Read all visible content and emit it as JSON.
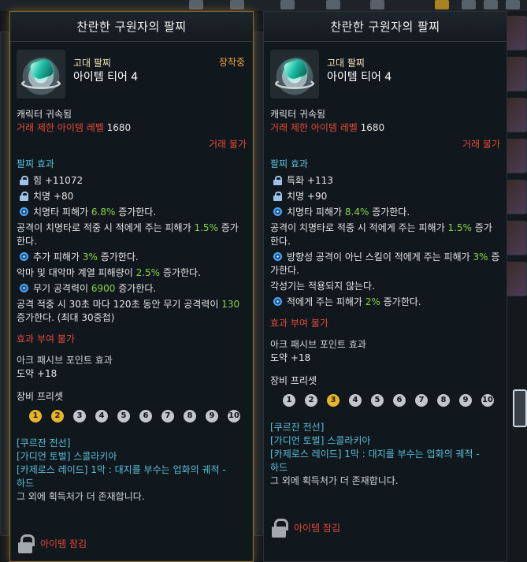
{
  "left": {
    "title": "찬란한 구원자의 팔찌",
    "grade": "고대 팔찌",
    "tier": "아이템 티어 4",
    "equipped": "장착중",
    "bound": "캐릭터 귀속됨",
    "level_label": "거래 제한 아이템 레벨",
    "level_value": "1680",
    "trade": "거래 불가",
    "effect_header": "팔찌 효과",
    "stat1": "힘 +11072",
    "stat2": "치명 +80",
    "e1a": "치명타 피해가 ",
    "e1v": "6.8%",
    "e1b": " 증가한다.",
    "e2a": "공격이 치명타로 적중 시 적에게 주는 피해가 ",
    "e2v": "1.5%",
    "e2b": " 증가한다.",
    "e3a": "추가 피해가 ",
    "e3v": "3%",
    "e3b": " 증가한다.",
    "e4a": "악마 및 대악마 계열 피해량이 ",
    "e4v": "2.5%",
    "e4b": " 증가한다.",
    "e5a": "무기 공격력이 ",
    "e5v": "6900",
    "e5b": " 증가한다.",
    "e6a": "공격 적중 시 30초 마다 120초 동안 무기 공격력이 ",
    "e6v": "130",
    "e6b": " 증가한다. (최대 30중첩)",
    "no_effect": "효과 부여 불가",
    "ark_header": "아크 패시브 포인트 효과",
    "ark_value": "도약 +18",
    "preset_header": "장비 프리셋",
    "preset": [
      "1",
      "2",
      "3",
      "4",
      "5",
      "6",
      "7",
      "8",
      "9",
      "10"
    ],
    "src1": "[쿠르잔 전선]",
    "src2": "[가디언 토벌] 스콜라키아",
    "src3": "[카제로스 레이드] 1막 : 대지를 부수는 업화의 궤적 -",
    "src3b": "하드",
    "src4": "그 외에 획득처가 더 존재합니다.",
    "locked": "아이템 잠김"
  },
  "right": {
    "title": "찬란한 구원자의 팔찌",
    "grade": "고대 팔찌",
    "tier": "아이템 티어 4",
    "bound": "캐릭터 귀속됨",
    "level_label": "거래 제한 아이템 레벨",
    "level_value": "1680",
    "trade": "거래 불가",
    "effect_header": "팔찌 효과",
    "stat1": "특화 +113",
    "stat2": "치명 +90",
    "e1a": "치명타 피해가 ",
    "e1v": "8.4%",
    "e1b": " 증가한다.",
    "e2a": "공격이 치명타로 적중 시 적에게 주는 피해가 ",
    "e2v": "1.5%",
    "e2b": " 증가한다.",
    "e3a": "방향성 공격이 아닌 스킬이 적에게 주는 피해가 ",
    "e3v": "3%",
    "e3b": " 증가한다.",
    "e4": "각성기는 적용되지 않는다.",
    "e5a": "적에게 주는 피해가 ",
    "e5v": "2%",
    "e5b": " 증가한다.",
    "no_effect": "효과 부여 불가",
    "ark_header": "아크 패시브 포인트 효과",
    "ark_value": "도약 +18",
    "preset_header": "장비 프리셋",
    "preset": [
      "1",
      "2",
      "3",
      "4",
      "5",
      "6",
      "7",
      "8",
      "9",
      "10"
    ],
    "src1": "[쿠르잔 전선]",
    "src2": "[가디언 토벌] 스콜라키아",
    "src3": "[카제로스 레이드] 1막 : 대지를 부수는 업화의 궤적 -",
    "src3b": "하드",
    "src4": "그 외에 획득처가 더 존재합니다.",
    "locked": "아이템 잠김"
  },
  "colors": {
    "red": "#e34a3a",
    "green": "#89d246",
    "gold": "#e8a43a",
    "preset_active": "#e8b52a",
    "source_blue": "#5bc0d8"
  },
  "icons": [
    "lock-icon",
    "buff-orb-icon",
    "bracelet-item-icon"
  ]
}
